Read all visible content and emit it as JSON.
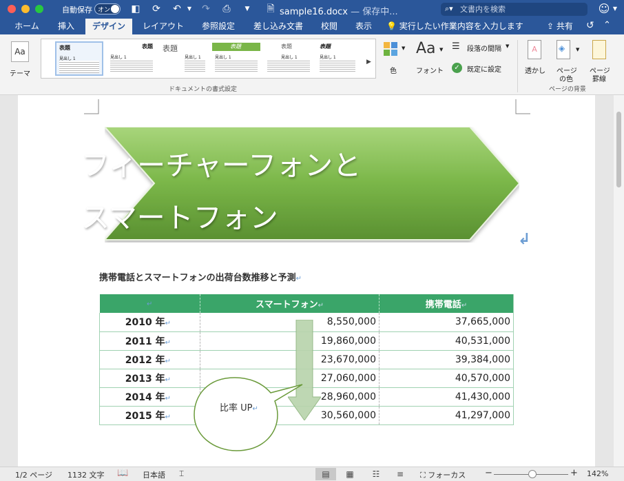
{
  "window": {
    "autosave_label": "自動保存",
    "autosave_state": "オン",
    "doc_name": "sample16.docx",
    "doc_status": " — 保存中...",
    "search_placeholder": "文書内を検索"
  },
  "tabs": [
    "ホーム",
    "挿入",
    "デザイン",
    "レイアウト",
    "参照設定",
    "差し込み文書",
    "校閲",
    "表示"
  ],
  "active_tab": "デザイン",
  "tell_me": "実行したい作業内容を入力します",
  "share_label": "共有",
  "ribbon": {
    "theme_label": "テーマ",
    "gallery_items": [
      {
        "title": "表題",
        "heading": "見出し 1"
      },
      {
        "title": "表題",
        "heading": "見出し 1"
      },
      {
        "title": "表題",
        "heading": "見出し 1"
      },
      {
        "title": "表題",
        "heading": "見出し 1"
      },
      {
        "title": "表題",
        "heading": "見出し 1"
      },
      {
        "title": "表題",
        "heading": "見出し 1"
      }
    ],
    "doc_format_group": "ドキュメントの書式設定",
    "color_label": "色",
    "font_label": "フォント",
    "paragraph_spacing_label": "段落の間隔",
    "set_default_label": "既定に設定",
    "watermark_label": "透かし",
    "page_color_label_1": "ページ",
    "page_color_label_2": "の色",
    "page_border_label_1": "ページ",
    "page_border_label_2": "罫線",
    "page_bg_group": "ページの背景"
  },
  "document": {
    "banner_line1": "フィーチャーフォンと",
    "banner_line2": "スマートフォン",
    "heading": "携帯電話とスマートフォンの出荷台数推移と予測",
    "table": {
      "headers": [
        "",
        "スマートフォン",
        "携帯電話"
      ],
      "rows": [
        {
          "year": "2010 年",
          "smart": "8,550,000",
          "feature": "37,665,000"
        },
        {
          "year": "2011 年",
          "smart": "19,860,000",
          "feature": "40,531,000"
        },
        {
          "year": "2012 年",
          "smart": "23,670,000",
          "feature": "39,384,000"
        },
        {
          "year": "2013 年",
          "smart": "27,060,000",
          "feature": "40,570,000"
        },
        {
          "year": "2014 年",
          "smart": "28,960,000",
          "feature": "41,430,000"
        },
        {
          "year": "2015 年",
          "smart": "30,560,000",
          "feature": "41,297,000"
        }
      ]
    },
    "bubble_text": "比率 UP",
    "colors": {
      "banner_green": "#7ab648",
      "table_header": "#3aa569",
      "arrow": "#b9d4ad",
      "bubble_border": "#6a9a3a"
    }
  },
  "status": {
    "page": "1/2 ページ",
    "words": "1132 文字",
    "language": "日本語",
    "focus_label": "フォーカス",
    "zoom": "142%"
  }
}
